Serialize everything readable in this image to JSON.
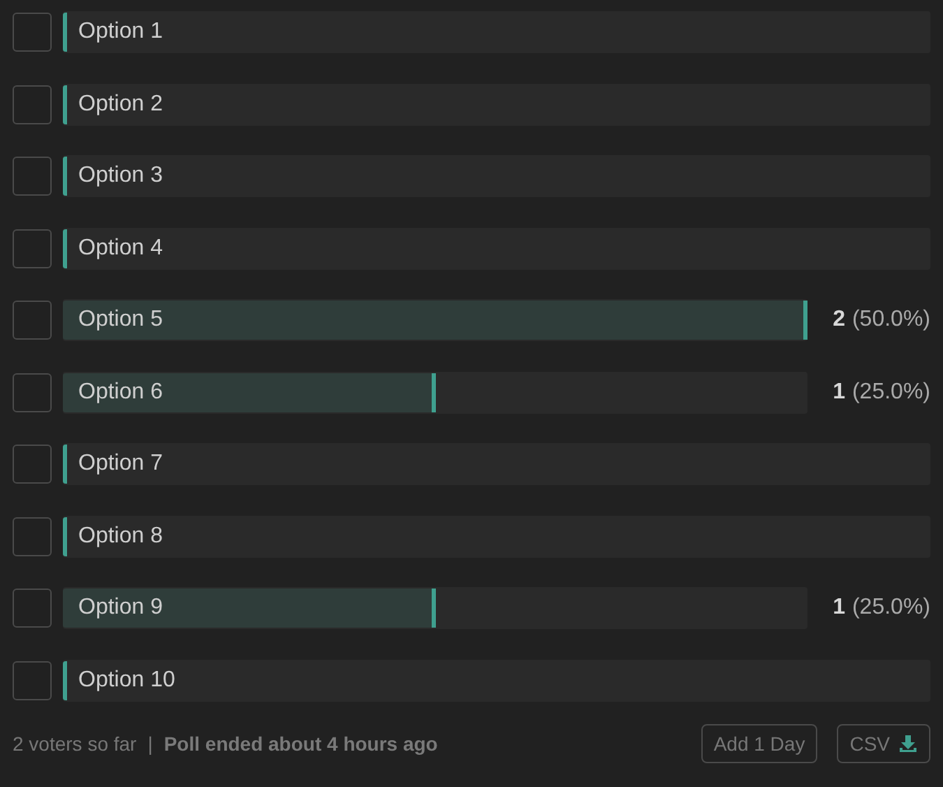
{
  "options": [
    {
      "label": "Option 1",
      "checked": false,
      "level": 0
    },
    {
      "label": "Option 2",
      "checked": false,
      "level": 0
    },
    {
      "label": "Option 3",
      "checked": false,
      "level": 0
    },
    {
      "label": "Option 4",
      "checked": false,
      "level": 0
    },
    {
      "label": "Option 5",
      "checked": false,
      "level": 1,
      "count": "2",
      "percent": "(50.0%)"
    },
    {
      "label": "Option 6",
      "checked": false,
      "level": 0.5,
      "count": "1",
      "percent": "(25.0%)"
    },
    {
      "label": "Option 7",
      "checked": false,
      "level": 0
    },
    {
      "label": "Option 8",
      "checked": false,
      "level": 0
    },
    {
      "label": "Option 9",
      "checked": false,
      "level": 0.5,
      "count": "1",
      "percent": "(25.0%)"
    },
    {
      "label": "Option 10",
      "checked": false,
      "level": 0
    }
  ],
  "footer": {
    "voters": "2 voters so far",
    "separator": "|",
    "status": "Poll ended about 4 hours ago",
    "buttons": [
      "Add 1 Day",
      "CSV"
    ]
  }
}
